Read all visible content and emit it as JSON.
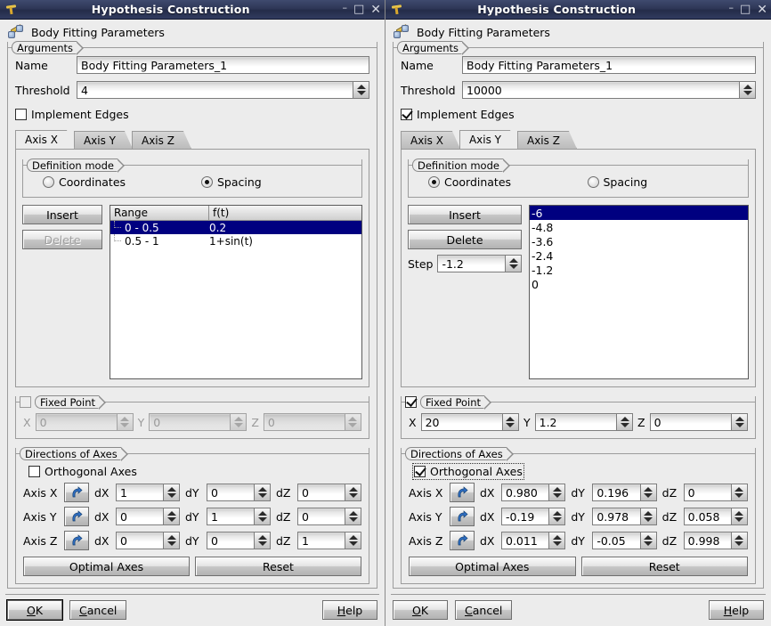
{
  "window_title": "Hypothesis Construction",
  "titlebar_buttons": {
    "minimize": "–",
    "maximize": "□",
    "close": "✕"
  },
  "header_title": "Body Fitting Parameters",
  "labels": {
    "arguments": "Arguments",
    "name": "Name",
    "threshold": "Threshold",
    "implement_edges": "Implement Edges",
    "definition_mode": "Definition mode",
    "coordinates": "Coordinates",
    "spacing": "Spacing",
    "insert": "Insert",
    "delete": "Delete",
    "step": "Step",
    "fixed_point": "Fixed Point",
    "directions_of_axes": "Directions of Axes",
    "orthogonal_axes": "Orthogonal Axes",
    "axis_x": "Axis X",
    "axis_y": "Axis Y",
    "axis_z": "Axis Z",
    "dx": "dX",
    "dy": "dY",
    "dz": "dZ",
    "x": "X",
    "y": "Y",
    "z": "Z",
    "optimal_axes": "Optimal Axes",
    "reset": "Reset",
    "range_col": "Range",
    "ft_col": "f(t)"
  },
  "bottom": {
    "ok": "OK",
    "cancel": "Cancel",
    "help": "Help"
  },
  "left": {
    "name_value": "Body Fitting Parameters_1",
    "threshold_value": "4",
    "implement_edges_checked": false,
    "selected_tab": "Axis X",
    "tabs": [
      "Axis X",
      "Axis Y",
      "Axis Z"
    ],
    "definition_mode": "Spacing",
    "delete_enabled": false,
    "show_step": false,
    "table_rows": [
      {
        "range": "0 - 0.5",
        "ft": "0.2",
        "selected": true
      },
      {
        "range": "0.5 - 1",
        "ft": "1+sin(t)",
        "selected": false
      }
    ],
    "fixed_point_checked": false,
    "fixed_point": {
      "x": "0",
      "y": "0",
      "z": "0"
    },
    "orthogonal_axes_checked": false,
    "axes": [
      {
        "name": "Axis X",
        "dx": "1",
        "dy": "0",
        "dz": "0"
      },
      {
        "name": "Axis Y",
        "dx": "0",
        "dy": "1",
        "dz": "0"
      },
      {
        "name": "Axis Z",
        "dx": "0",
        "dy": "0",
        "dz": "1"
      }
    ],
    "ok_focused": true
  },
  "right": {
    "name_value": "Body Fitting Parameters_1",
    "threshold_value": "10000",
    "implement_edges_checked": true,
    "selected_tab": "Axis Y",
    "tabs": [
      "Axis X",
      "Axis Y",
      "Axis Z"
    ],
    "definition_mode": "Coordinates",
    "delete_enabled": true,
    "show_step": true,
    "step_value": "-1.2",
    "list_items": [
      {
        "value": "-6",
        "selected": true
      },
      {
        "value": "-4.8",
        "selected": false
      },
      {
        "value": "-3.6",
        "selected": false
      },
      {
        "value": "-2.4",
        "selected": false
      },
      {
        "value": "-1.2",
        "selected": false
      },
      {
        "value": "0",
        "selected": false
      }
    ],
    "fixed_point_checked": true,
    "fixed_point": {
      "x": "20",
      "y": "1.2",
      "z": "0"
    },
    "orthogonal_axes_checked": true,
    "axes": [
      {
        "name": "Axis X",
        "dx": "0.980",
        "dy": "0.196",
        "dz": "0"
      },
      {
        "name": "Axis Y",
        "dx": "-0.19",
        "dy": "0.978",
        "dz": "0.058"
      },
      {
        "name": "Axis Z",
        "dx": "0.011",
        "dy": "-0.05",
        "dz": "0.998"
      }
    ],
    "ok_focused": false
  },
  "colors": {
    "titlebar": "#2e3757",
    "selection": "#000080",
    "window_bg": "#ececec",
    "field_bg": "#ffffff"
  }
}
